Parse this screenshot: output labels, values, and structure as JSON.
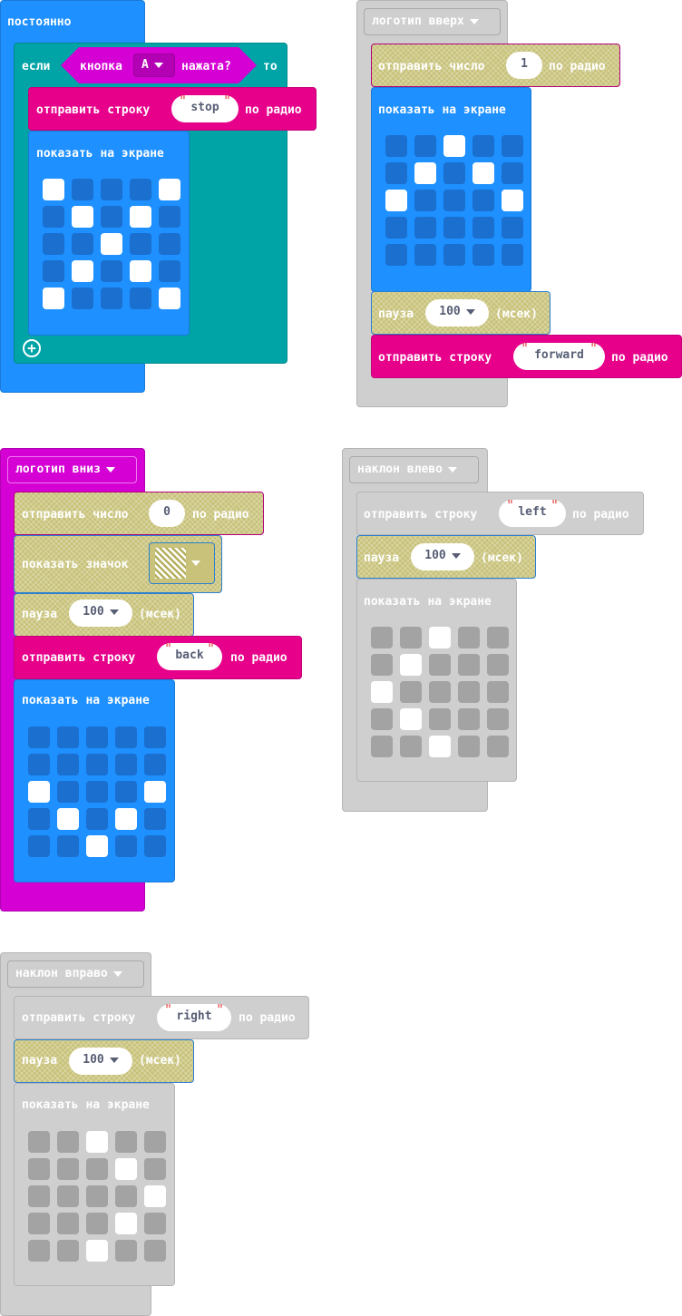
{
  "colors": {
    "blue": "#1e90ff",
    "teal": "#00a4a6",
    "magenta": "#e6008a",
    "purple": "#d400d4",
    "gray": "#cfcfcf",
    "olive": "#c8c27a",
    "led_on": "#ffffff",
    "led_off_blue": "#1a6fcf",
    "led_off_gray": "#a3a3a3"
  },
  "forever": {
    "hat_label": "постоянно",
    "if_label": "если",
    "button_label": "кнопка",
    "button_value": "A",
    "pressed_label": "нажата?",
    "then_label": "то",
    "send_string_label": "отправить строку",
    "send_string_value": "stop",
    "radio_label": "по радио",
    "show_leds_label": "показать на экране",
    "leds": [
      [
        1,
        0,
        0,
        0,
        1
      ],
      [
        0,
        1,
        0,
        1,
        0
      ],
      [
        0,
        0,
        1,
        0,
        0
      ],
      [
        0,
        1,
        0,
        1,
        0
      ],
      [
        1,
        0,
        0,
        0,
        1
      ]
    ],
    "add_icon": "plus-circle-icon"
  },
  "logo_up": {
    "hat_label": "логотип вверх",
    "send_number_label": "отправить число",
    "send_number_value": "1",
    "radio_label": "по радио",
    "show_leds_label": "показать на экране",
    "leds": [
      [
        0,
        0,
        1,
        0,
        0
      ],
      [
        0,
        1,
        0,
        1,
        0
      ],
      [
        1,
        0,
        0,
        0,
        1
      ],
      [
        0,
        0,
        0,
        0,
        0
      ],
      [
        0,
        0,
        0,
        0,
        0
      ]
    ],
    "pause_label": "пауза",
    "pause_value": "100",
    "ms_label": "(мсек)",
    "send_string_label": "отправить строку",
    "send_string_value": "forward",
    "radio_label2": "по радио"
  },
  "logo_down": {
    "hat_label": "логотип вниз",
    "send_number_label": "отправить число",
    "send_number_value": "0",
    "radio_label": "по радио",
    "show_icon_label": "показать значок",
    "pause_label": "пауза",
    "pause_value": "100",
    "ms_label": "(мсек)",
    "send_string_label": "отправить строку",
    "send_string_value": "back",
    "radio_label2": "по радио",
    "show_leds_label": "показать на экране",
    "leds": [
      [
        0,
        0,
        0,
        0,
        0
      ],
      [
        0,
        0,
        0,
        0,
        0
      ],
      [
        1,
        0,
        0,
        0,
        1
      ],
      [
        0,
        1,
        0,
        1,
        0
      ],
      [
        0,
        0,
        1,
        0,
        0
      ]
    ]
  },
  "tilt_left": {
    "hat_label": "наклон влево",
    "send_string_label": "отправить строку",
    "send_string_value": "left",
    "radio_label": "по радио",
    "pause_label": "пауза",
    "pause_value": "100",
    "ms_label": "(мсек)",
    "show_leds_label": "показать на экране",
    "leds": [
      [
        0,
        0,
        1,
        0,
        0
      ],
      [
        0,
        1,
        0,
        0,
        0
      ],
      [
        1,
        0,
        0,
        0,
        0
      ],
      [
        0,
        1,
        0,
        0,
        0
      ],
      [
        0,
        0,
        1,
        0,
        0
      ]
    ]
  },
  "tilt_right": {
    "hat_label": "наклон вправо",
    "send_string_label": "отправить строку",
    "send_string_value": "right",
    "radio_label": "по радио",
    "pause_label": "пауза",
    "pause_value": "100",
    "ms_label": "(мсек)",
    "show_leds_label": "показать на экране",
    "leds": [
      [
        0,
        0,
        1,
        0,
        0
      ],
      [
        0,
        0,
        0,
        1,
        0
      ],
      [
        0,
        0,
        0,
        0,
        1
      ],
      [
        0,
        0,
        0,
        1,
        0
      ],
      [
        0,
        0,
        1,
        0,
        0
      ]
    ]
  }
}
